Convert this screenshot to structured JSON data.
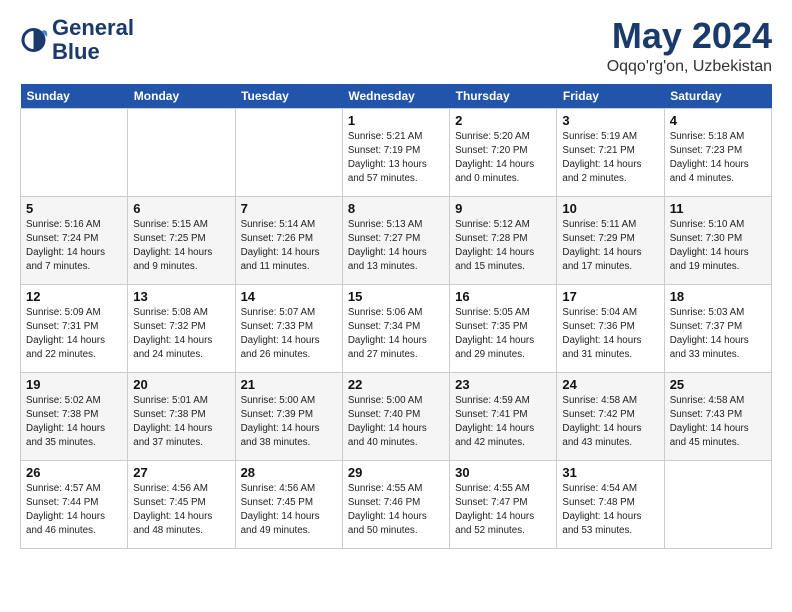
{
  "header": {
    "logo_line1": "General",
    "logo_line2": "Blue",
    "month": "May 2024",
    "location": "Oqqo'rg'on, Uzbekistan"
  },
  "days_of_week": [
    "Sunday",
    "Monday",
    "Tuesday",
    "Wednesday",
    "Thursday",
    "Friday",
    "Saturday"
  ],
  "weeks": [
    [
      {
        "day": "",
        "info": ""
      },
      {
        "day": "",
        "info": ""
      },
      {
        "day": "",
        "info": ""
      },
      {
        "day": "1",
        "info": "Sunrise: 5:21 AM\nSunset: 7:19 PM\nDaylight: 13 hours and 57 minutes."
      },
      {
        "day": "2",
        "info": "Sunrise: 5:20 AM\nSunset: 7:20 PM\nDaylight: 14 hours and 0 minutes."
      },
      {
        "day": "3",
        "info": "Sunrise: 5:19 AM\nSunset: 7:21 PM\nDaylight: 14 hours and 2 minutes."
      },
      {
        "day": "4",
        "info": "Sunrise: 5:18 AM\nSunset: 7:23 PM\nDaylight: 14 hours and 4 minutes."
      }
    ],
    [
      {
        "day": "5",
        "info": "Sunrise: 5:16 AM\nSunset: 7:24 PM\nDaylight: 14 hours and 7 minutes."
      },
      {
        "day": "6",
        "info": "Sunrise: 5:15 AM\nSunset: 7:25 PM\nDaylight: 14 hours and 9 minutes."
      },
      {
        "day": "7",
        "info": "Sunrise: 5:14 AM\nSunset: 7:26 PM\nDaylight: 14 hours and 11 minutes."
      },
      {
        "day": "8",
        "info": "Sunrise: 5:13 AM\nSunset: 7:27 PM\nDaylight: 14 hours and 13 minutes."
      },
      {
        "day": "9",
        "info": "Sunrise: 5:12 AM\nSunset: 7:28 PM\nDaylight: 14 hours and 15 minutes."
      },
      {
        "day": "10",
        "info": "Sunrise: 5:11 AM\nSunset: 7:29 PM\nDaylight: 14 hours and 17 minutes."
      },
      {
        "day": "11",
        "info": "Sunrise: 5:10 AM\nSunset: 7:30 PM\nDaylight: 14 hours and 19 minutes."
      }
    ],
    [
      {
        "day": "12",
        "info": "Sunrise: 5:09 AM\nSunset: 7:31 PM\nDaylight: 14 hours and 22 minutes."
      },
      {
        "day": "13",
        "info": "Sunrise: 5:08 AM\nSunset: 7:32 PM\nDaylight: 14 hours and 24 minutes."
      },
      {
        "day": "14",
        "info": "Sunrise: 5:07 AM\nSunset: 7:33 PM\nDaylight: 14 hours and 26 minutes."
      },
      {
        "day": "15",
        "info": "Sunrise: 5:06 AM\nSunset: 7:34 PM\nDaylight: 14 hours and 27 minutes."
      },
      {
        "day": "16",
        "info": "Sunrise: 5:05 AM\nSunset: 7:35 PM\nDaylight: 14 hours and 29 minutes."
      },
      {
        "day": "17",
        "info": "Sunrise: 5:04 AM\nSunset: 7:36 PM\nDaylight: 14 hours and 31 minutes."
      },
      {
        "day": "18",
        "info": "Sunrise: 5:03 AM\nSunset: 7:37 PM\nDaylight: 14 hours and 33 minutes."
      }
    ],
    [
      {
        "day": "19",
        "info": "Sunrise: 5:02 AM\nSunset: 7:38 PM\nDaylight: 14 hours and 35 minutes."
      },
      {
        "day": "20",
        "info": "Sunrise: 5:01 AM\nSunset: 7:38 PM\nDaylight: 14 hours and 37 minutes."
      },
      {
        "day": "21",
        "info": "Sunrise: 5:00 AM\nSunset: 7:39 PM\nDaylight: 14 hours and 38 minutes."
      },
      {
        "day": "22",
        "info": "Sunrise: 5:00 AM\nSunset: 7:40 PM\nDaylight: 14 hours and 40 minutes."
      },
      {
        "day": "23",
        "info": "Sunrise: 4:59 AM\nSunset: 7:41 PM\nDaylight: 14 hours and 42 minutes."
      },
      {
        "day": "24",
        "info": "Sunrise: 4:58 AM\nSunset: 7:42 PM\nDaylight: 14 hours and 43 minutes."
      },
      {
        "day": "25",
        "info": "Sunrise: 4:58 AM\nSunset: 7:43 PM\nDaylight: 14 hours and 45 minutes."
      }
    ],
    [
      {
        "day": "26",
        "info": "Sunrise: 4:57 AM\nSunset: 7:44 PM\nDaylight: 14 hours and 46 minutes."
      },
      {
        "day": "27",
        "info": "Sunrise: 4:56 AM\nSunset: 7:45 PM\nDaylight: 14 hours and 48 minutes."
      },
      {
        "day": "28",
        "info": "Sunrise: 4:56 AM\nSunset: 7:45 PM\nDaylight: 14 hours and 49 minutes."
      },
      {
        "day": "29",
        "info": "Sunrise: 4:55 AM\nSunset: 7:46 PM\nDaylight: 14 hours and 50 minutes."
      },
      {
        "day": "30",
        "info": "Sunrise: 4:55 AM\nSunset: 7:47 PM\nDaylight: 14 hours and 52 minutes."
      },
      {
        "day": "31",
        "info": "Sunrise: 4:54 AM\nSunset: 7:48 PM\nDaylight: 14 hours and 53 minutes."
      },
      {
        "day": "",
        "info": ""
      }
    ]
  ]
}
